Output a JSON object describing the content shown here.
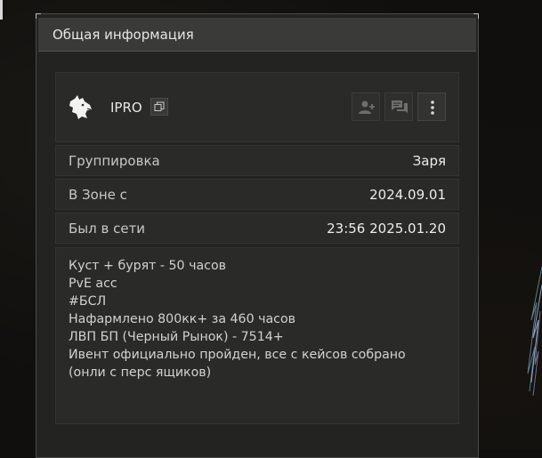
{
  "panel": {
    "title": "Общая информация"
  },
  "profile": {
    "username": "IPRO",
    "avatar_icon": "wolf-head-icon",
    "copy_icon": "copy-icon",
    "actions": {
      "add_friend_icon": "add-friend-icon",
      "message_icon": "message-icon",
      "menu_icon": "more-vertical-icon"
    }
  },
  "info": [
    {
      "label": "Группировка",
      "value": "Заря"
    },
    {
      "label": "В Зоне с",
      "value": "2024.09.01"
    },
    {
      "label": "Был в сети",
      "value": "23:56 2025.01.20"
    }
  ],
  "bio": {
    "lines": [
      "Куст + бурят - 50 часов",
      "PvE acc",
      "#БСЛ",
      "Нафармлено 800кк+ за 460 часов",
      "ЛВП БП (Черный Рынок) - 7514+",
      "Ивент официально пройден, все с кейсов собрано",
      "(онли с перс ящиков)"
    ]
  },
  "colors": {
    "panel_bg": "#232322",
    "header_bg": "#3a3a38",
    "card_bg": "#2a2a29",
    "text": "#e6e6e6"
  }
}
